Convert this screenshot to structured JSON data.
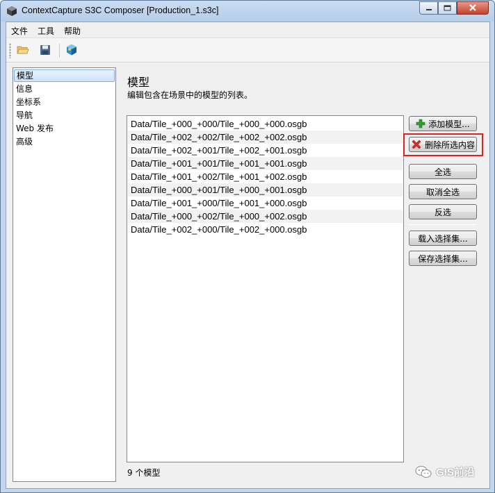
{
  "window": {
    "title": "ContextCapture S3C Composer [Production_1.s3c]",
    "buttons": {
      "minimize": "minimize-icon",
      "maximize": "maximize-icon",
      "close": "close-icon"
    }
  },
  "menubar": {
    "items": [
      "文件",
      "工具",
      "帮助"
    ]
  },
  "toolbar": {
    "icons": [
      "open-folder-icon",
      "save-icon",
      "export-3d-icon"
    ]
  },
  "nav": {
    "items": [
      {
        "label": "模型",
        "selected": true
      },
      {
        "label": "信息",
        "selected": false
      },
      {
        "label": "坐标系",
        "selected": false
      },
      {
        "label": "导航",
        "selected": false
      },
      {
        "label": "Web 发布",
        "selected": false
      },
      {
        "label": "高级",
        "selected": false
      }
    ]
  },
  "main": {
    "title": "模型",
    "description": "编辑包含在场景中的模型的列表。",
    "models": [
      "Data/Tile_+000_+000/Tile_+000_+000.osgb",
      "Data/Tile_+002_+002/Tile_+002_+002.osgb",
      "Data/Tile_+002_+001/Tile_+002_+001.osgb",
      "Data/Tile_+001_+001/Tile_+001_+001.osgb",
      "Data/Tile_+001_+002/Tile_+001_+002.osgb",
      "Data/Tile_+000_+001/Tile_+000_+001.osgb",
      "Data/Tile_+001_+000/Tile_+001_+000.osgb",
      "Data/Tile_+000_+002/Tile_+000_+002.osgb",
      "Data/Tile_+002_+000/Tile_+002_+000.osgb"
    ],
    "buttons": {
      "add": "添加模型...",
      "delete": "删除所选内容",
      "select_all": "全选",
      "deselect_all": "取消全选",
      "invert": "反选",
      "load_selection": "载入选择集...",
      "save_selection": "保存选择集..."
    },
    "status": "9 个模型"
  },
  "watermark": {
    "text": "GIS前沿"
  },
  "colors": {
    "highlight": "#e01f1f",
    "add_icon": "#2e9e2e",
    "delete_icon": "#d9302a"
  }
}
